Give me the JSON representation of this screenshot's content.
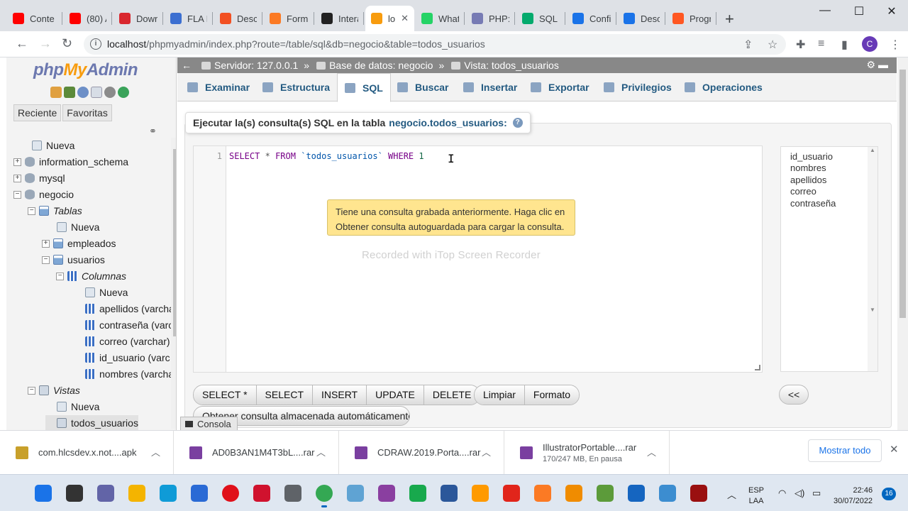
{
  "browser": {
    "tabs": [
      {
        "title": "Conte",
        "icon": "youtube-icon",
        "color": "#ff0000"
      },
      {
        "title": "(80) A",
        "icon": "youtube-icon",
        "color": "#ff0000"
      },
      {
        "title": "Down",
        "icon": "mega-icon",
        "color": "#d9272e"
      },
      {
        "title": "FLA E",
        "icon": "fla-icon",
        "color": "#3c6fd1"
      },
      {
        "title": "Desca",
        "icon": "windows-icon",
        "color": "#f25022"
      },
      {
        "title": "Form",
        "icon": "xampp-icon",
        "color": "#fb7a24"
      },
      {
        "title": "Intera",
        "icon": "e-icon",
        "color": "#222222"
      },
      {
        "title": "lo",
        "icon": "phpmyadmin-icon",
        "color": "#f89c0e"
      },
      {
        "title": "Whats",
        "icon": "whatsapp-icon",
        "color": "#25d366"
      },
      {
        "title": "PHP: I",
        "icon": "php-icon",
        "color": "#777bb4"
      },
      {
        "title": "SQL C",
        "icon": "w3schools-icon",
        "color": "#04aa6d"
      },
      {
        "title": "Confi",
        "icon": "gear-icon",
        "color": "#1a73e8"
      },
      {
        "title": "Desca",
        "icon": "download-icon",
        "color": "#1a73e8"
      },
      {
        "title": "Progr",
        "icon": "blogger-icon",
        "color": "#ff5722"
      }
    ],
    "url_host": "localhost",
    "url_path": "/phpmyadmin/index.php?route=/table/sql&db=negocio&table=todos_usuarios",
    "profile_initial": "C"
  },
  "nav": {
    "logo_php": "php",
    "logo_my": "My",
    "logo_admin": "Admin",
    "tabs": [
      "Reciente",
      "Favoritas"
    ],
    "tree": [
      {
        "label": "Nueva",
        "icon": "new"
      },
      {
        "label": "information_schema",
        "icon": "db",
        "exp": "+"
      },
      {
        "label": "mysql",
        "icon": "db",
        "exp": "+"
      },
      {
        "label": "negocio",
        "icon": "db",
        "exp": "−"
      },
      {
        "label": "Tablas",
        "icon": "tbl",
        "exp": "−"
      },
      {
        "label": "Nueva",
        "icon": "new"
      },
      {
        "label": "empleados",
        "icon": "tbl",
        "exp": "+"
      },
      {
        "label": "usuarios",
        "icon": "tbl",
        "exp": "−"
      },
      {
        "label": "Columnas",
        "icon": "col",
        "exp": "−"
      },
      {
        "label": "Nueva",
        "icon": "new"
      },
      {
        "label": "apellidos (varcha",
        "icon": "col"
      },
      {
        "label": "contraseña (varc",
        "icon": "col"
      },
      {
        "label": "correo (varchar)",
        "icon": "col"
      },
      {
        "label": "id_usuario (varc",
        "icon": "col"
      },
      {
        "label": "nombres (varcha",
        "icon": "col"
      },
      {
        "label": "Vistas",
        "icon": "view",
        "exp": "−"
      },
      {
        "label": "Nueva",
        "icon": "new"
      },
      {
        "label": "todos_usuarios",
        "icon": "view"
      }
    ]
  },
  "main": {
    "breadcrumb": {
      "server": "Servidor: 127.0.0.1",
      "database": "Base de datos: negocio",
      "view": "Vista: todos_usuarios"
    },
    "menu": [
      "Examinar",
      "Estructura",
      "SQL",
      "Buscar",
      "Insertar",
      "Exportar",
      "Privilegios",
      "Operaciones"
    ],
    "sql_legend_prefix": "Ejecutar la(s) consulta(s) SQL en la tabla",
    "sql_legend_table": "negocio.todos_usuarios:",
    "editor": {
      "line_number": "1",
      "kw1": "SELECT",
      "star": "*",
      "kw2": "FROM",
      "table": "`todos_usuarios`",
      "kw3": "WHERE",
      "num": "1"
    },
    "autosave_notice": "Tiene una consulta grabada anteriormente. Haga clic en Obtener consulta autoguardada para cargar la consulta.",
    "watermark": "Recorded with iTop Screen Recorder",
    "fields": [
      "id_usuario",
      "nombres",
      "apellidos",
      "correo",
      "contraseña"
    ],
    "query_buttons": [
      "SELECT *",
      "SELECT",
      "INSERT",
      "UPDATE",
      "DELETE"
    ],
    "format_buttons": [
      "Limpiar",
      "Formato"
    ],
    "insert_field_button": "<<",
    "restore_button": "Obtener consulta almacenada automáticamente",
    "console": "Consola"
  },
  "downloads": [
    {
      "name": "com.hlcsdev.x.not....apk",
      "sub": "",
      "color": "#c8a02a"
    },
    {
      "name": "AD0B3AN1M4T3bL....rar",
      "sub": "",
      "color": "#7a3fa0"
    },
    {
      "name": "CDRAW.2019.Porta....rar",
      "sub": "",
      "color": "#7a3fa0"
    },
    {
      "name": "IllustratorPortable....rar",
      "sub": "170/247 MB, En pausa",
      "color": "#7a3fa0"
    }
  ],
  "show_all": "Mostrar todo",
  "taskbar": {
    "lang_1": "ESP",
    "lang_2": "LAA",
    "time": "22:46",
    "date": "30/07/2022",
    "badge": "16"
  }
}
